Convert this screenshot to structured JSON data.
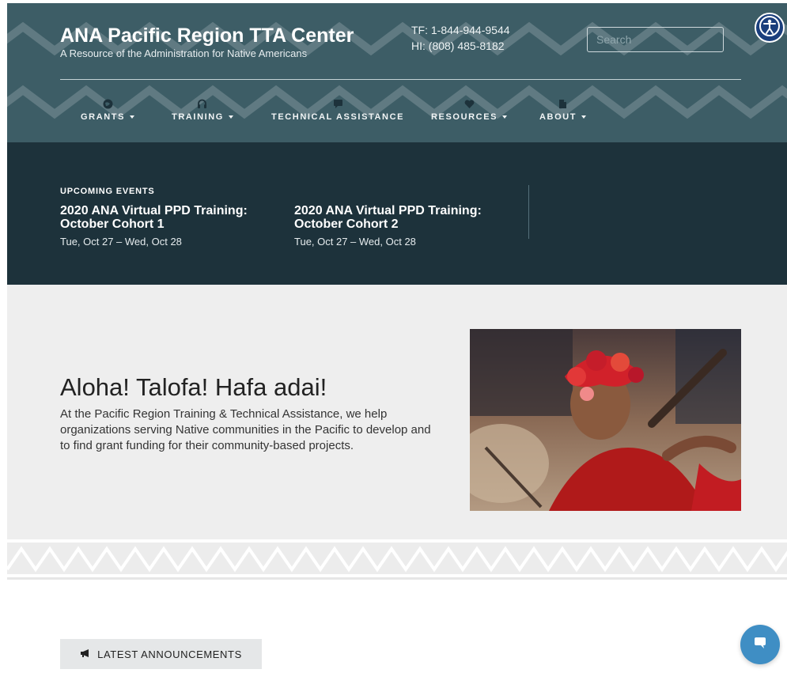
{
  "header": {
    "title": "ANA Pacific Region TTA Center",
    "subtitle": "A Resource of the Administration for Native Americans",
    "phone_tf": "TF: 1-844-944-9544",
    "phone_hi": "HI: (808) 485-8182",
    "search_placeholder": "Search"
  },
  "nav": {
    "items": [
      {
        "label": "GRANTS",
        "icon": "globe-icon"
      },
      {
        "label": "TRAINING",
        "icon": "headphones-icon"
      },
      {
        "label": "TECHNICAL ASSISTANCE",
        "icon": "chat-icon"
      },
      {
        "label": "RESOURCES",
        "icon": "heart-icon"
      },
      {
        "label": "ABOUT",
        "icon": "document-icon"
      }
    ]
  },
  "events": {
    "heading": "UPCOMING EVENTS",
    "items": [
      {
        "title": "2020 ANA Virtual PPD Training: October Cohort 1",
        "date": "Tue, Oct 27 – Wed, Oct 28"
      },
      {
        "title": "2020 ANA Virtual PPD Training: October Cohort 2",
        "date": "Tue, Oct 27 – Wed, Oct 28"
      }
    ]
  },
  "hero": {
    "title": "Aloha! Talofa! Hafa adai!",
    "text": "At the Pacific Region Training & Technical Assistance, we help organizations serving Native communities in the Pacific to develop and to find grant funding for their community-based projects."
  },
  "announcements": {
    "label": "LATEST ANNOUNCEMENTS",
    "icon": "megaphone-icon"
  },
  "colors": {
    "header_bg": "#3d5d66",
    "events_bg": "#1d323b",
    "hero_bg": "#eeeeee",
    "chat_button": "#3f8ec4",
    "accessibility_button": "#1a3e7c"
  }
}
